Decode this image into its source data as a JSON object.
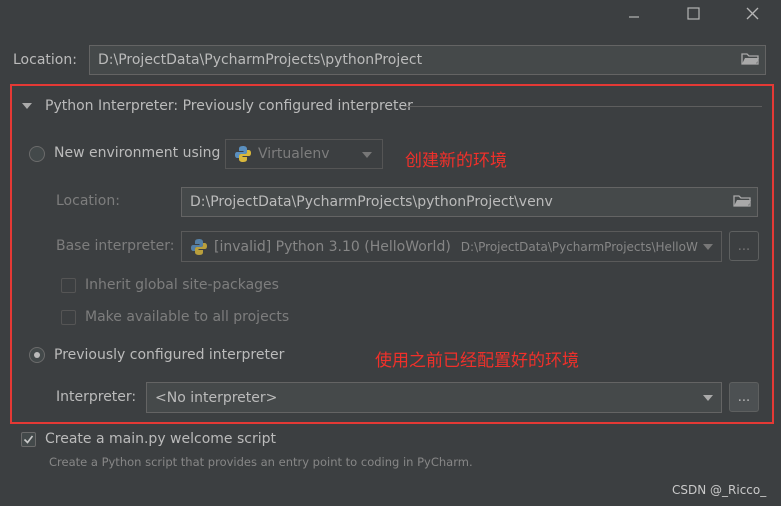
{
  "window": {
    "minimize_icon": "minimize-icon",
    "maximize_icon": "maximize-icon",
    "close_icon": "close-icon"
  },
  "location": {
    "label": "Location:",
    "value": "D:\\ProjectData\\PycharmProjects\\pythonProject"
  },
  "interpreter_section": {
    "title": "Python Interpreter: Previously configured interpreter"
  },
  "new_env": {
    "radio_label": "New environment using",
    "tool": "Virtualenv",
    "location_label": "Location:",
    "location_value": "D:\\ProjectData\\PycharmProjects\\pythonProject\\venv",
    "base_label": "Base interpreter:",
    "base_value": "[invalid] Python 3.10 (HelloWorld)",
    "base_path": "D:\\ProjectData\\PycharmProjects\\HelloW",
    "inherit_label": "Inherit global site-packages",
    "make_available_label": "Make available to all projects",
    "ellipsis": "..."
  },
  "prev_interpreter": {
    "radio_label": "Previously configured interpreter",
    "interp_label": "Interpreter:",
    "interp_value": "<No interpreter>",
    "ellipsis": "..."
  },
  "welcome": {
    "checkbox_label": "Create a main.py welcome script",
    "hint": "Create a Python script that provides an entry point to coding in PyCharm."
  },
  "annotations": {
    "new_env_note": "创建新的环境",
    "prev_note": "使用之前已经配置好的环境"
  },
  "watermark": "CSDN @_Ricco_",
  "colors": {
    "annotation_red": "#e53935",
    "background": "#3c3f41"
  }
}
